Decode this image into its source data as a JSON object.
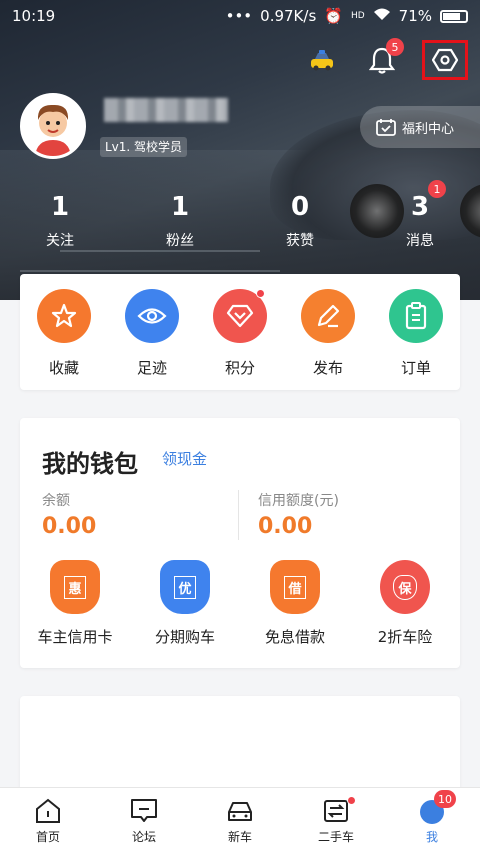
{
  "status_bar": {
    "time": "10:19",
    "speed": "0.97K/s",
    "network": "HD",
    "battery": "71%"
  },
  "header": {
    "notification_badge": "5",
    "welfare_label": "福利中心",
    "level_tag": "Lv1. 驾校学员"
  },
  "stats": [
    {
      "value": "1",
      "label": "关注",
      "badge": ""
    },
    {
      "value": "1",
      "label": "粉丝",
      "badge": ""
    },
    {
      "value": "0",
      "label": "获赞",
      "badge": ""
    },
    {
      "value": "3",
      "label": "消息",
      "badge": "1"
    }
  ],
  "actions": [
    {
      "label": "收藏",
      "icon": "star-icon",
      "color": "#f5782e"
    },
    {
      "label": "足迹",
      "icon": "eye-icon",
      "color": "#3f83ee"
    },
    {
      "label": "积分",
      "icon": "diamond-icon",
      "color": "#f0554e"
    },
    {
      "label": "发布",
      "icon": "pencil-icon",
      "color": "#f5802f"
    },
    {
      "label": "订单",
      "icon": "clipboard-icon",
      "color": "#2fc58f"
    }
  ],
  "wallet": {
    "title": "我的钱包",
    "get_cash": "领现金",
    "balance_label": "余额",
    "balance_value": "0.00",
    "credit_label": "信用额度(元)",
    "credit_value": "0.00",
    "services": [
      {
        "label": "车主信用卡",
        "glyph": "惠",
        "color": "#f5782e"
      },
      {
        "label": "分期购车",
        "glyph": "优",
        "color": "#3f83ee"
      },
      {
        "label": "免息借款",
        "glyph": "借",
        "color": "#f5782e"
      },
      {
        "label": "2折车险",
        "glyph": "保",
        "color": "#f0554e"
      }
    ]
  },
  "bottom_nav": [
    {
      "label": "首页",
      "icon": "home-icon"
    },
    {
      "label": "论坛",
      "icon": "forum-icon"
    },
    {
      "label": "新车",
      "icon": "car-icon"
    },
    {
      "label": "二手车",
      "icon": "exchange-icon"
    },
    {
      "label": "我",
      "icon": "me-icon",
      "badge": "10"
    }
  ]
}
